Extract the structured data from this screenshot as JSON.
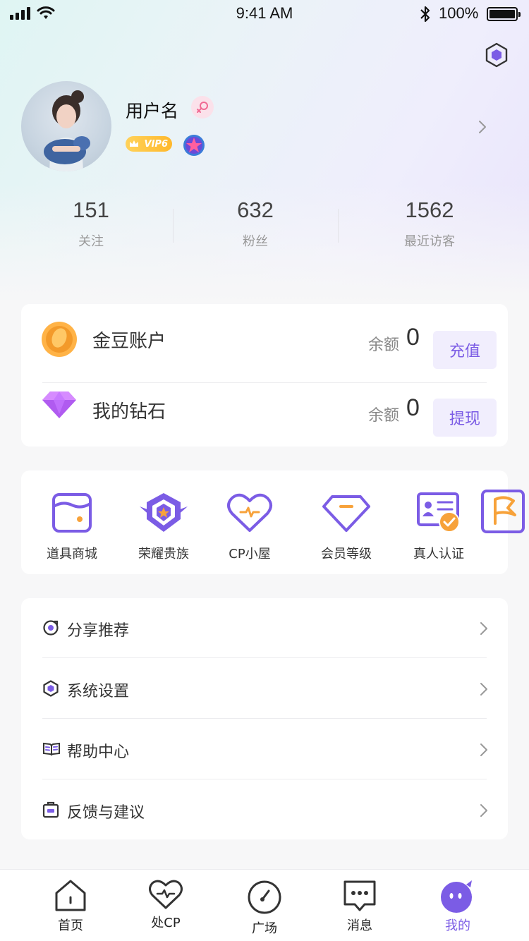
{
  "status_bar": {
    "time": "9:41 AM",
    "battery": "100%"
  },
  "profile": {
    "username": "用户名",
    "vip_label": "VIP6",
    "stats": [
      {
        "value": "151",
        "label": "关注"
      },
      {
        "value": "632",
        "label": "粉丝"
      },
      {
        "value": "1562",
        "label": "最近访客"
      }
    ]
  },
  "wallet": {
    "gold": {
      "title": "金豆账户",
      "balance_label": "余额",
      "balance": "0",
      "button": "充值"
    },
    "diamond": {
      "title": "我的钻石",
      "balance_label": "余额",
      "balance": "0",
      "button": "提现"
    }
  },
  "features": [
    {
      "label": "道具商城",
      "icon": "shop-icon"
    },
    {
      "label": "荣耀贵族",
      "icon": "noble-badge-icon"
    },
    {
      "label": "CP小屋",
      "icon": "heart-icon"
    },
    {
      "label": "会员等级",
      "icon": "diamond-level-icon"
    },
    {
      "label": "真人认证",
      "icon": "id-verify-icon"
    },
    {
      "label": "",
      "icon": "flag-icon"
    }
  ],
  "menu": [
    {
      "label": "分享推荐",
      "icon": "share-icon"
    },
    {
      "label": "系统设置",
      "icon": "settings-hex-icon"
    },
    {
      "label": "帮助中心",
      "icon": "book-icon"
    },
    {
      "label": "反馈与建议",
      "icon": "feedback-icon"
    }
  ],
  "tabs": [
    {
      "label": "首页",
      "icon": "home-icon"
    },
    {
      "label": "处CP",
      "icon": "heart-pulse-icon"
    },
    {
      "label": "广场",
      "icon": "compass-icon"
    },
    {
      "label": "消息",
      "icon": "message-icon"
    },
    {
      "label": "我的",
      "icon": "mascot-icon",
      "active": true
    }
  ],
  "colors": {
    "accent": "#7b5ce5",
    "accent_light": "#f1eefd",
    "gold": "#f7a23a"
  }
}
